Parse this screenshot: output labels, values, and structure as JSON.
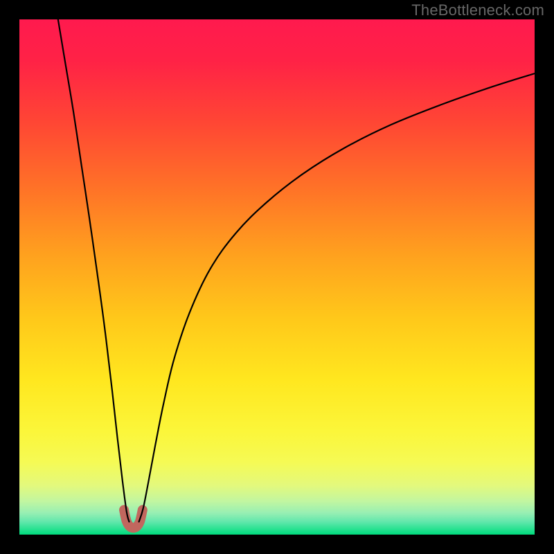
{
  "watermark": "TheBottleneck.com",
  "colors": {
    "nub_stroke": "#c1675e",
    "curve_stroke": "#000000",
    "frame": "#000000",
    "gradient_stops": [
      {
        "offset": 0.0,
        "color": "#ff1a4e"
      },
      {
        "offset": 0.08,
        "color": "#ff2246"
      },
      {
        "offset": 0.2,
        "color": "#ff4634"
      },
      {
        "offset": 0.33,
        "color": "#ff7327"
      },
      {
        "offset": 0.46,
        "color": "#ffa21e"
      },
      {
        "offset": 0.58,
        "color": "#ffc81a"
      },
      {
        "offset": 0.7,
        "color": "#ffe71f"
      },
      {
        "offset": 0.8,
        "color": "#fbf63a"
      },
      {
        "offset": 0.86,
        "color": "#f5fa55"
      },
      {
        "offset": 0.905,
        "color": "#e3f97d"
      },
      {
        "offset": 0.935,
        "color": "#c2f6a0"
      },
      {
        "offset": 0.958,
        "color": "#97efb3"
      },
      {
        "offset": 0.975,
        "color": "#62e7ac"
      },
      {
        "offset": 0.988,
        "color": "#2de293"
      },
      {
        "offset": 1.0,
        "color": "#00db7d"
      }
    ]
  },
  "chart_data": {
    "type": "line",
    "title": "",
    "xlabel": "",
    "ylabel": "",
    "xlim": [
      0,
      100
    ],
    "ylim": [
      0,
      100
    ],
    "grid": false,
    "series": [
      {
        "name": "left-branch",
        "x": [
          7.5,
          9,
          10.5,
          12,
          13.5,
          15,
          16.5,
          18,
          19,
          20,
          20.8,
          21.3
        ],
        "y": [
          100,
          91,
          82,
          72,
          62,
          51.5,
          40.5,
          28,
          19,
          10.5,
          4.5,
          2.5
        ]
      },
      {
        "name": "right-branch",
        "x": [
          23.2,
          24,
          25,
          26.5,
          28,
          30,
          33,
          37,
          42,
          48,
          55,
          63,
          72,
          82,
          92,
          100
        ],
        "y": [
          2.5,
          5,
          10,
          18,
          25.5,
          34,
          43,
          51.5,
          58.5,
          64.5,
          70,
          75,
          79.5,
          83.5,
          87,
          89.5
        ]
      },
      {
        "name": "valley-nub",
        "x": [
          20.3,
          20.8,
          21.4,
          22.1,
          22.8,
          23.4,
          23.9
        ],
        "y": [
          4.8,
          2.6,
          1.6,
          1.3,
          1.6,
          2.6,
          4.8
        ]
      }
    ]
  }
}
